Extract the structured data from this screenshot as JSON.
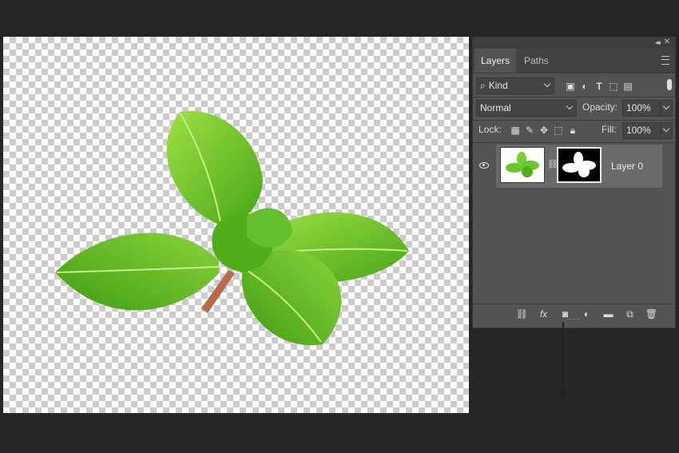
{
  "panel": {
    "tabs": [
      {
        "label": "Layers",
        "active": true
      },
      {
        "label": "Paths",
        "active": false
      }
    ],
    "filter": {
      "kind_label": "Kind",
      "icons": [
        "image-icon",
        "adjustment-icon",
        "type-icon",
        "shape-icon",
        "smart-object-icon"
      ]
    },
    "blend": {
      "mode": "Normal",
      "opacity_label": "Opacity:",
      "opacity_value": "100%"
    },
    "lock": {
      "label": "Lock:",
      "icons": [
        "lock-transparent-icon",
        "lock-paint-icon",
        "lock-position-icon",
        "lock-artboard-icon",
        "lock-all-icon"
      ],
      "fill_label": "Fill:",
      "fill_value": "100%"
    },
    "layers": [
      {
        "name": "Layer 0",
        "visible": true,
        "has_mask": true
      }
    ],
    "bottom_icons": [
      "link-icon",
      "fx-icon",
      "add-mask-icon",
      "adjustment-layer-icon",
      "folder-icon",
      "new-layer-icon",
      "trash-icon"
    ]
  },
  "colors": {
    "leaf_light": "#8fd63a",
    "leaf_mid": "#5cb81f",
    "leaf_dark": "#3e9912",
    "stem": "#b86a4a"
  }
}
